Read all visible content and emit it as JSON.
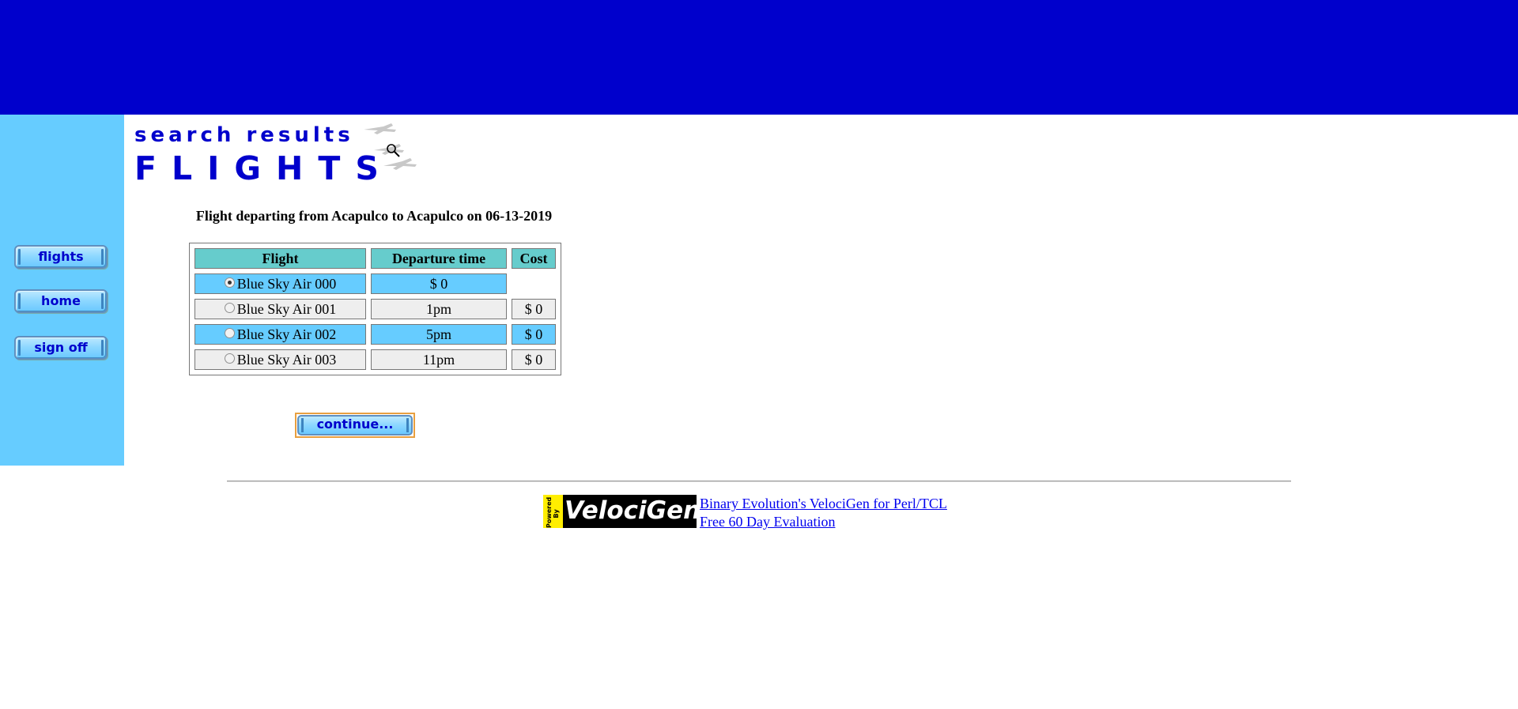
{
  "colors": {
    "top_bar": "#0000cc",
    "sidebar": "#66ccff",
    "header_cell": "#66cccc",
    "row_highlight": "#66ccff",
    "row_plain": "#eeeeee",
    "link": "#0000ee"
  },
  "sidebar": {
    "items": [
      {
        "label": "flights"
      },
      {
        "label": "home"
      },
      {
        "label": "sign off"
      }
    ]
  },
  "heading": {
    "subtitle": "search results",
    "title": "FLIGHTS",
    "icon": "planes-magnifier-icon"
  },
  "results": {
    "caption": "Flight departing from Acapulco to Acapulco on 06-13-2019",
    "columns": [
      "Flight",
      "Departure time",
      "Cost"
    ],
    "rows": [
      {
        "flight": "Blue Sky Air 000",
        "departure": "$ 0",
        "cost": "",
        "selected": true,
        "highlight": true
      },
      {
        "flight": "Blue Sky Air 001",
        "departure": "1pm",
        "cost": "$ 0",
        "selected": false,
        "highlight": false
      },
      {
        "flight": "Blue Sky Air 002",
        "departure": "5pm",
        "cost": "$ 0",
        "selected": false,
        "highlight": true
      },
      {
        "flight": "Blue Sky Air 003",
        "departure": "11pm",
        "cost": "$ 0",
        "selected": false,
        "highlight": false
      }
    ],
    "continue_label": "continue..."
  },
  "footer": {
    "logo": {
      "badge": "Powered By",
      "word": "VelociGen!"
    },
    "link1": "Binary Evolution's VelociGen for Perl/TCL",
    "link2": "Free 60 Day Evaluation"
  }
}
